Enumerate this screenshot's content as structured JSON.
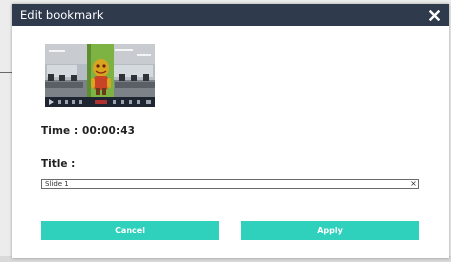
{
  "dialog": {
    "title": "Edit bookmark",
    "close_icon": "close-icon"
  },
  "thumbnail": {
    "description_icon": "video-thumbnail"
  },
  "time": {
    "label": "Time : 00:00:43"
  },
  "title_field": {
    "label": "Title :",
    "value": "Slide 1",
    "clear_glyph": "×"
  },
  "buttons": {
    "cancel_label": "Cancel",
    "apply_label": "Apply"
  },
  "colors": {
    "titlebar": "#2f3a4d",
    "accent": "#2fd1bd"
  }
}
